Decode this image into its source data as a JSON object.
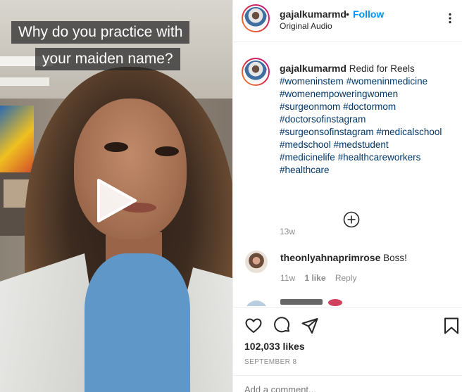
{
  "video": {
    "caption_line1": "Why do you practice with",
    "caption_line2": "your maiden name?",
    "play_icon": "play-icon"
  },
  "header": {
    "username": "gajalkumarmd",
    "separator": "•",
    "follow_label": "Follow",
    "subtitle": "Original Audio",
    "more_icon": "more-options-icon"
  },
  "post": {
    "username": "gajalkumarmd",
    "text": "Redid for Reels",
    "hashtags": [
      "#womeninstem",
      "#womeninmedicine",
      "#womenempoweringwomen",
      "#surgeonmom",
      "#doctormom",
      "#doctorsofinstagram",
      "#surgeonsofinstagram",
      "#medicalschool",
      "#medschool",
      "#medstudent",
      "#medicinelife",
      "#healthcareworkers",
      "#healthcare"
    ],
    "time_ago": "13w",
    "load_more_icon": "plus-circle-icon"
  },
  "comments": [
    {
      "username": "theonlyahnaprimrose",
      "text": "Boss!",
      "time_ago": "11w",
      "likes": "1 like",
      "reply_label": "Reply"
    }
  ],
  "actions": {
    "icons": [
      "heart-icon",
      "comment-icon",
      "share-icon",
      "bookmark-icon"
    ],
    "likes": "102,033 likes",
    "date": "SEPTEMBER 8",
    "add_comment_placeholder": "Add a comment..."
  },
  "colors": {
    "accent": "#0095f6",
    "hashtag": "#00376b",
    "muted": "#8e8e8e",
    "text": "#262626",
    "divider": "#efefef"
  }
}
